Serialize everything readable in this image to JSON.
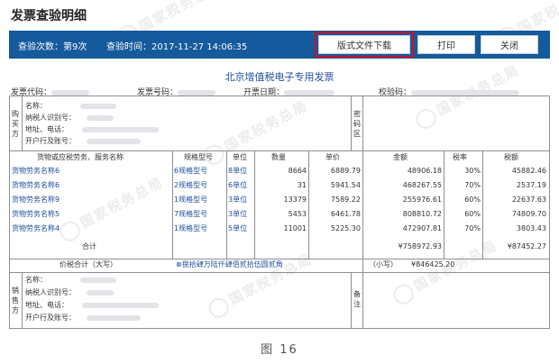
{
  "page_title": "发票查验明细",
  "toolbar": {
    "check_count": "查验次数：第9次",
    "check_time": "查验时间：2017-11-27 14:06:35",
    "download_label": "版式文件下载",
    "print_label": "打印",
    "close_label": "关闭"
  },
  "watermark": "国家税务总局",
  "invoice": {
    "title": "北京增值税电子专用发票",
    "code_label": "发票代码：",
    "number_label": "发票号码：",
    "date_label": "开票日期：",
    "check_code_label": "校验码：",
    "buyer": {
      "side_label": "购买方",
      "name_label": "名称：",
      "tax_id_label": "纳税人识别号：",
      "address_label": "地址、电话：",
      "bank_label": "开户行及账号："
    },
    "password_area_label": "密码区",
    "headers": {
      "item": "货物或应税劳务、服务名称",
      "spec": "规格型号",
      "unit": "单位",
      "qty": "数量",
      "price": "单价",
      "amount": "金额",
      "rate": "税率",
      "tax": "税额"
    },
    "rows": [
      {
        "item": "货物劳务名称6",
        "spec": "6规格型号",
        "unit": "8单位",
        "qty": "8664",
        "price": "6889.79",
        "amount": "48906.18",
        "rate": "30%",
        "tax": "45882.46"
      },
      {
        "item": "货物劳务名称6",
        "spec": "2规格型号",
        "unit": "6单位",
        "qty": "31",
        "price": "5941.54",
        "amount": "468267.55",
        "rate": "70%",
        "tax": "2537.19"
      },
      {
        "item": "货物劳务名称9",
        "spec": "1规格型号",
        "unit": "3单位",
        "qty": "13379",
        "price": "7589.22",
        "amount": "255976.61",
        "rate": "60%",
        "tax": "22637.63"
      },
      {
        "item": "货物劳务名称5",
        "spec": "7规格型号",
        "unit": "3单位",
        "qty": "5453",
        "price": "6461.78",
        "amount": "808810.72",
        "rate": "60%",
        "tax": "74809.70"
      },
      {
        "item": "货物劳务名称4",
        "spec": "1规格型号",
        "unit": "5单位",
        "qty": "11001",
        "price": "5225.30",
        "amount": "472907.81",
        "rate": "70%",
        "tax": "3803.43"
      }
    ],
    "total_label": "合计",
    "total_amount": "¥758972.93",
    "total_tax": "¥87452.27",
    "grand_total_label": "价税合计（大写）",
    "grand_total_upper": "⊗捌拾肆万陆仟肆佰贰拾伍圆贰角",
    "grand_total_small_label": "（小写）",
    "grand_total_small": "¥846425.20",
    "seller": {
      "side_label": "销售方",
      "name_label": "名称：",
      "tax_id_label": "纳税人识别号：",
      "address_label": "地址、电话：",
      "bank_label": "开户行及账号："
    },
    "remarks_label": "备注"
  },
  "caption": "图 16"
}
